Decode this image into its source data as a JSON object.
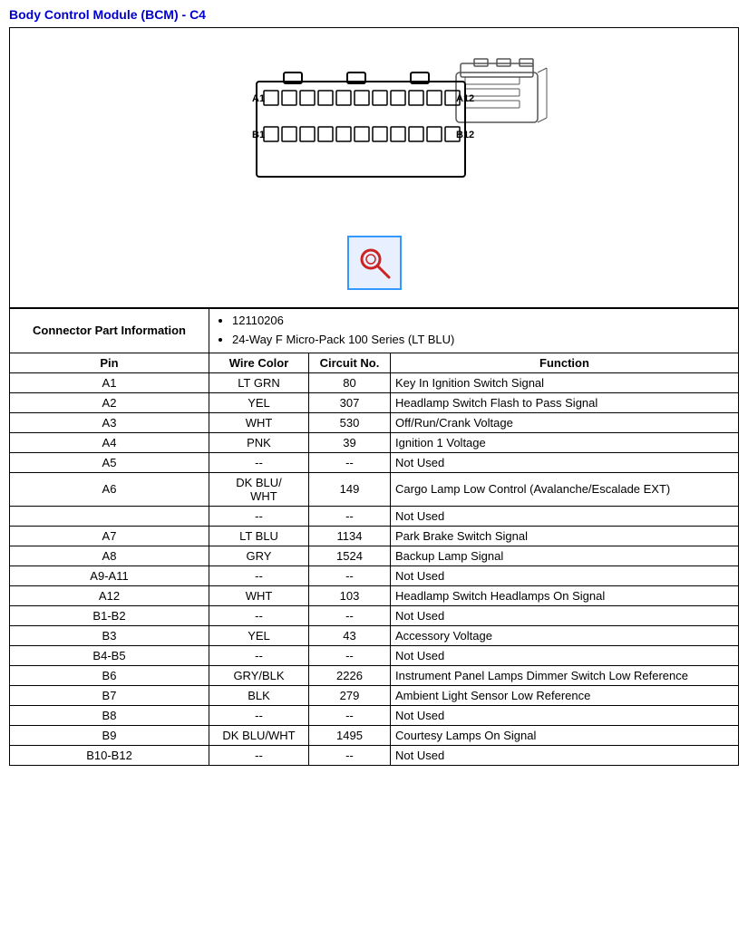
{
  "title": "Body Control Module (BCM) - C4",
  "connector_info_label": "Connector Part Information",
  "connector_part_number": "12110206",
  "connector_description": "24-Way F Micro-Pack 100 Series (LT BLU)",
  "table_headers": {
    "pin": "Pin",
    "wire_color": "Wire Color",
    "circuit_no": "Circuit No.",
    "function": "Function"
  },
  "rows": [
    {
      "pin": "A1",
      "wire_color": "LT GRN",
      "circuit": "80",
      "function": "Key In Ignition Switch Signal",
      "multirow": false
    },
    {
      "pin": "A2",
      "wire_color": "YEL",
      "circuit": "307",
      "function": "Headlamp Switch Flash to Pass Signal",
      "multirow": false
    },
    {
      "pin": "A3",
      "wire_color": "WHT",
      "circuit": "530",
      "function": "Off/Run/Crank Voltage",
      "multirow": false
    },
    {
      "pin": "A4",
      "wire_color": "PNK",
      "circuit": "39",
      "function": "Ignition 1 Voltage",
      "multirow": false
    },
    {
      "pin": "A5",
      "wire_color": "--",
      "circuit": "--",
      "function": "Not Used",
      "multirow": false
    },
    {
      "pin": "A6",
      "wire_color": "DK BLU/   WHT",
      "circuit": "149",
      "function": "Cargo Lamp Low Control (Avalanche/Escalade EXT)",
      "multirow": true
    },
    {
      "pin": "",
      "wire_color": "--",
      "circuit": "--",
      "function": "Not Used",
      "multirow": false,
      "extra": true
    },
    {
      "pin": "A7",
      "wire_color": "LT BLU",
      "circuit": "1134",
      "function": "Park Brake Switch Signal",
      "multirow": false
    },
    {
      "pin": "A8",
      "wire_color": "GRY",
      "circuit": "1524",
      "function": "Backup Lamp Signal",
      "multirow": false
    },
    {
      "pin": "A9-A11",
      "wire_color": "--",
      "circuit": "--",
      "function": "Not Used",
      "multirow": false
    },
    {
      "pin": "A12",
      "wire_color": "WHT",
      "circuit": "103",
      "function": "Headlamp Switch Headlamps On Signal",
      "multirow": false
    },
    {
      "pin": "B1-B2",
      "wire_color": "--",
      "circuit": "--",
      "function": "Not Used",
      "multirow": false
    },
    {
      "pin": "B3",
      "wire_color": "YEL",
      "circuit": "43",
      "function": "Accessory Voltage",
      "multirow": false
    },
    {
      "pin": "B4-B5",
      "wire_color": "--",
      "circuit": "--",
      "function": "Not Used",
      "multirow": false
    },
    {
      "pin": "B6",
      "wire_color": "GRY/BLK",
      "circuit": "2226",
      "function": "Instrument Panel Lamps Dimmer Switch Low Reference",
      "multirow": false
    },
    {
      "pin": "B7",
      "wire_color": "BLK",
      "circuit": "279",
      "function": "Ambient Light Sensor Low Reference",
      "multirow": false
    },
    {
      "pin": "B8",
      "wire_color": "--",
      "circuit": "--",
      "function": "Not Used",
      "multirow": false
    },
    {
      "pin": "B9",
      "wire_color": "DK BLU/WHT",
      "circuit": "1495",
      "function": "Courtesy Lamps On Signal",
      "multirow": false
    },
    {
      "pin": "B10-B12",
      "wire_color": "--",
      "circuit": "--",
      "function": "Not Used",
      "multirow": false
    }
  ]
}
